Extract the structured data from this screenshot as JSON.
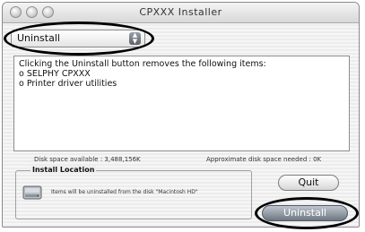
{
  "window": {
    "title": "CPXXX Installer"
  },
  "popup": {
    "selected": "Uninstall",
    "arrows_icon": "popup-arrows-icon"
  },
  "info": {
    "lines": [
      "Clicking the Uninstall button removes the following items:",
      "o SELPHY CPXXX",
      "o Printer driver utilities"
    ]
  },
  "disk": {
    "available": "Disk space available : 3,488,156K",
    "needed": "Approximate disk space needed : 0K"
  },
  "install_location": {
    "label": "Install Location",
    "text": "Items will be uninstalled from the disk \"Macintosh HD\"",
    "icon": "hard-disk-icon"
  },
  "buttons": {
    "quit": "Quit",
    "uninstall": "Uninstall"
  }
}
